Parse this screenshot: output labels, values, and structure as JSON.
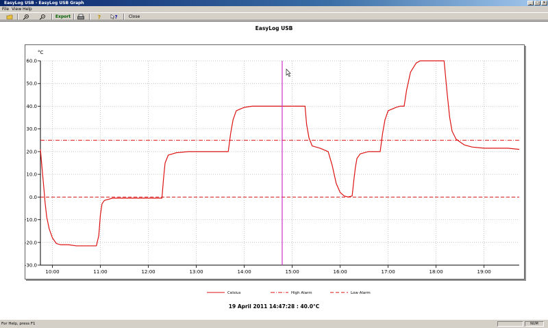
{
  "window": {
    "title": "EasyLog USB - EasyLog USB Graph",
    "minimize": "_",
    "maximize": "□",
    "close": "×"
  },
  "menu": [
    "File",
    "View",
    "Help"
  ],
  "toolbar": {
    "export_label": "Export",
    "close_label": "Close",
    "open_icon": "open-folder-icon",
    "zoom_in_icon": "zoom-in-icon",
    "zoom_out_icon": "zoom-out-icon",
    "print_icon": "printer-icon",
    "help_icon": "help-icon",
    "context_help_icon": "context-help-icon"
  },
  "statusbar": {
    "help_text": "For Help, press F1",
    "num": "NUM"
  },
  "chart_data": {
    "type": "line",
    "title": "EasyLog USB",
    "ylabel": "°C",
    "ylim": [
      -30,
      60
    ],
    "yticks": [
      "60.0",
      "50.0",
      "40.0",
      "30.0",
      "20.0",
      "10.0",
      "0.0",
      "-10.0",
      "-20.0",
      "-30.0"
    ],
    "xticks": [
      "10:00",
      "11:00",
      "12:00",
      "13:00",
      "14:00",
      "15:00",
      "16:00",
      "17:00",
      "18:00",
      "19:00"
    ],
    "xlim": [
      "09:45",
      "19:44"
    ],
    "grid": true,
    "high_alarm": 25.0,
    "low_alarm": 0.0,
    "cursor": {
      "time": "14:47:28",
      "value": 40.0
    },
    "cursor_readout": "19 April 2011 14:47:28 : 40.0°C",
    "colors": {
      "series": "#dd1111",
      "cursor": "#cc33cc",
      "grid": "#b0b0b0"
    },
    "legend": {
      "position": "bottom",
      "entries": [
        "Celsius",
        "High Alarm",
        "Low Alarm"
      ]
    },
    "series": [
      {
        "name": "Celsius",
        "x": [
          "09:45",
          "09:47",
          "09:49",
          "09:51",
          "09:53",
          "09:56",
          "10:00",
          "10:05",
          "10:10",
          "10:20",
          "10:30",
          "10:45",
          "10:55",
          "10:58",
          "11:00",
          "11:02",
          "11:05",
          "11:10",
          "11:15",
          "11:30",
          "12:00",
          "12:17",
          "12:19",
          "12:21",
          "12:25",
          "12:35",
          "12:50",
          "13:30",
          "13:40",
          "13:43",
          "13:46",
          "13:50",
          "14:00",
          "14:10",
          "15:00",
          "15:16",
          "15:18",
          "15:21",
          "15:25",
          "15:35",
          "15:45",
          "15:50",
          "15:55",
          "16:00",
          "16:05",
          "16:10",
          "16:15",
          "16:17",
          "16:19",
          "16:21",
          "16:25",
          "16:35",
          "16:45",
          "16:50",
          "16:53",
          "16:56",
          "17:00",
          "17:10",
          "17:15",
          "17:20",
          "17:23",
          "17:28",
          "17:35",
          "17:40",
          "17:45",
          "18:00",
          "18:10",
          "18:14",
          "18:17",
          "18:20",
          "18:25",
          "18:35",
          "18:45",
          "19:00",
          "19:15",
          "19:30",
          "19:44"
        ],
        "values": [
          21.0,
          13.0,
          5.0,
          -3.0,
          -9.0,
          -14.0,
          -18.0,
          -20.5,
          -21.0,
          -21.0,
          -21.5,
          -21.5,
          -21.5,
          -17.0,
          -8.0,
          -3.0,
          -1.5,
          -1.0,
          -0.5,
          -0.5,
          -0.5,
          -0.5,
          8.0,
          15.0,
          18.5,
          19.5,
          20.0,
          20.0,
          20.0,
          28.0,
          34.0,
          38.0,
          39.5,
          40.0,
          40.0,
          40.0,
          32.0,
          26.0,
          22.5,
          21.5,
          20.0,
          14.0,
          6.0,
          2.0,
          0.5,
          0.0,
          0.5,
          7.0,
          13.0,
          17.0,
          19.0,
          20.0,
          20.0,
          20.0,
          28.0,
          34.0,
          38.0,
          39.5,
          40.0,
          40.0,
          47.0,
          55.0,
          59.0,
          60.0,
          60.0,
          60.0,
          60.0,
          45.0,
          35.0,
          29.0,
          25.5,
          23.0,
          22.0,
          21.5,
          21.5,
          21.5,
          21.0
        ]
      }
    ]
  }
}
